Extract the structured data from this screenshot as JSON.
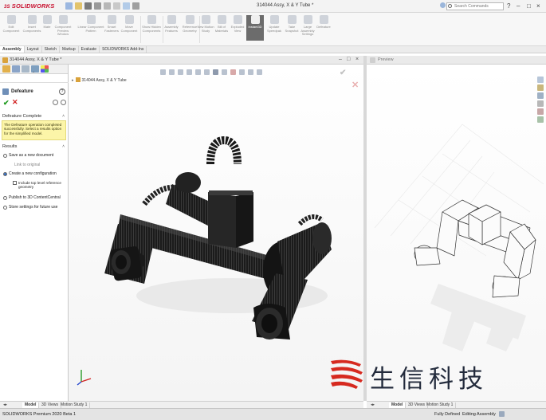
{
  "app": {
    "brand": "SOLIDWORKS",
    "brand_prefix": "3S",
    "document_title": "314044 Assy, X & Y Tube *",
    "search_placeholder": "Search Commands"
  },
  "ribbon": {
    "buttons": [
      {
        "label": "Edit Component"
      },
      {
        "label": "Insert Components"
      },
      {
        "label": "Mate"
      },
      {
        "label": "Component Preview Window"
      },
      {
        "label": "Linear Component Pattern"
      },
      {
        "label": "Smart Fasteners"
      },
      {
        "label": "Move Component"
      },
      {
        "label": "Show Hidden Components"
      },
      {
        "label": "Assembly Features"
      },
      {
        "label": "Reference Geometry"
      },
      {
        "label": "New Motion Study"
      },
      {
        "label": "Bill of Materials"
      },
      {
        "label": "Exploded View"
      },
      {
        "label": "Instant3D"
      },
      {
        "label": "Update Speedpak"
      },
      {
        "label": "Take Snapshot"
      },
      {
        "label": "Large Assembly Settings"
      },
      {
        "label": "Defeature"
      }
    ]
  },
  "command_tabs": [
    "Assembly",
    "Layout",
    "Sketch",
    "Markup",
    "Evaluate",
    "SOLIDWORKS Add-Ins"
  ],
  "main_window": {
    "title": "314044 Assy, X & Y Tube *"
  },
  "property_manager": {
    "title": "Defeature",
    "message_group": "Defeature Complete",
    "message": "The Defeature operation completed successfully. Select a results option for the simplified model.",
    "results_group": "Results",
    "options": {
      "save_new": "Save as a new document",
      "link_original": "Link to original",
      "new_config": "Create a new configuration",
      "include_top_level": "Include top level reference geometry",
      "publish": "Publish to 3D ContentCentral",
      "store_settings": "Store settings for future use"
    }
  },
  "viewport": {
    "tree_label": "314044 Assy, X & Y Tube"
  },
  "preview_pane": {
    "title": "Preview"
  },
  "bottom_tabs_left": [
    "Model",
    "3D Views",
    "Motion Study 1"
  ],
  "bottom_tabs_right": [
    "Model",
    "3D Views",
    "Motion Study 1"
  ],
  "status_bar": {
    "product": "SOLIDWORKS Premium 2020 Beta 1",
    "state": "Fully Defined",
    "mode": "Editing Assembly"
  },
  "watermark": {
    "text": "生信科技"
  },
  "colors": {
    "brand_red": "#c8102e",
    "message_yellow": "#fcf5a8",
    "ok_green": "#1e9a1e",
    "cancel_red": "#d12222"
  }
}
